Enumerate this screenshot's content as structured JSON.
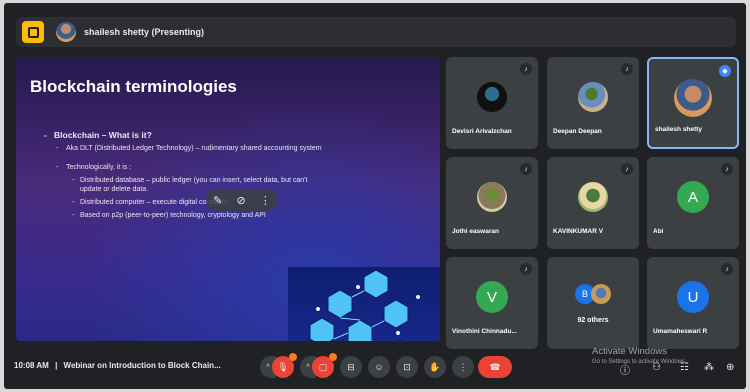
{
  "topbar": {
    "presenter_label": "shailesh shetty (Presenting)"
  },
  "slide": {
    "title": "Blockchain terminologies",
    "heading": "Blockchain – What is it?",
    "aka": "Aka DLT (Distributed Ledger Technology) – rudimentary shared accounting system",
    "tech": "Technologically, it is :",
    "points": [
      "Distributed database – public ledger (you can insert, select data, but can't update or delete data.",
      "Distributed computer – execute digital contracts",
      "Based on p2p (peer-to-peer) technology, cryptology and API"
    ]
  },
  "participants": [
    {
      "name": "Devisri Arivalzchan",
      "kind": "photo1"
    },
    {
      "name": "Deepan Deepan",
      "kind": "photo2"
    },
    {
      "name": "shailesh shetty",
      "kind": "photo3"
    },
    {
      "name": "Jothi easwaran",
      "kind": "photo4"
    },
    {
      "name": "KAVINKUMAR V",
      "kind": "photo5"
    },
    {
      "name": "Abi",
      "initial": "A",
      "color": "#34a853"
    },
    {
      "name": "Vinothini Chinnadu...",
      "initial": "V",
      "color": "#34a853"
    },
    {
      "name": "92 others",
      "initial": "B",
      "color": "#1a73e8"
    },
    {
      "name": "Umamaheswari R",
      "initial": "U",
      "color": "#1a73e8"
    }
  ],
  "bottombar": {
    "time": "10:08 AM",
    "separator": "|",
    "meeting_title": "Webinar on Introduction to Block Chain...",
    "watermark_line1": "Activate Windows",
    "watermark_line2": "Go to Settings to activate Windows."
  },
  "colors": {
    "background": "#202124",
    "tile": "#3c4043",
    "end_call": "#ea4335",
    "active_border": "#8ab4f8"
  }
}
